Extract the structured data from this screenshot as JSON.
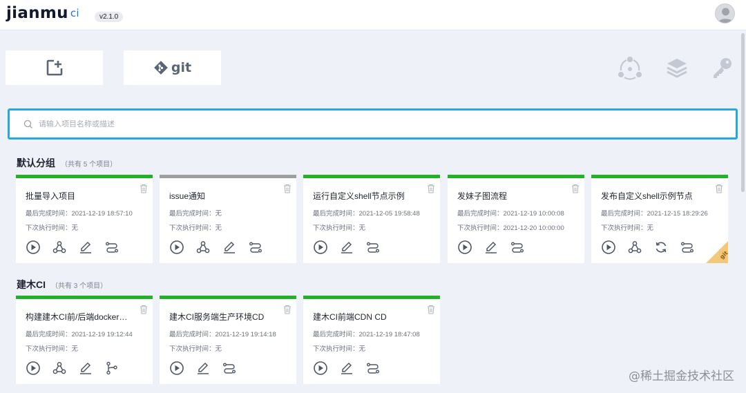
{
  "header": {
    "logo_text": "jianmu",
    "logo_suffix": "ci",
    "version": "v2.1.0"
  },
  "toolbar": {
    "git_label": "git"
  },
  "search": {
    "placeholder": "请输入项目名称或描述"
  },
  "groups": [
    {
      "name": "默认分组",
      "count_text": "（共有 5 个项目）",
      "projects": [
        {
          "name": "批量导入项目",
          "last_label": "最后完成时间：",
          "last_value": "2021-12-19 18:57:10",
          "next_label": "下次执行时间：",
          "next_value": "无",
          "status": "success"
        },
        {
          "name": "issue通知",
          "last_label": "最后完成时间：",
          "last_value": "无",
          "next_label": "下次执行时间：",
          "next_value": "无",
          "status": "never"
        },
        {
          "name": "运行自定义shell节点示例",
          "last_label": "最后完成时间：",
          "last_value": "2021-12-05 19:58:48",
          "next_label": "下次执行时间：",
          "next_value": "无",
          "status": "success"
        },
        {
          "name": "发妹子图流程",
          "last_label": "最后完成时间：",
          "last_value": "2021-12-19 10:00:08",
          "next_label": "下次执行时间：",
          "next_value": "2021-12-20 10:00:00",
          "status": "success"
        },
        {
          "name": "发布自定义shell示例节点",
          "last_label": "最后完成时间：",
          "last_value": "2021-12-15 18:29:26",
          "next_label": "下次执行时间：",
          "next_value": "无",
          "status": "success",
          "corner_badge": "git"
        }
      ]
    },
    {
      "name": "建木CI",
      "count_text": "（共有 3 个项目）",
      "projects": [
        {
          "name": "构建建木CI前/后端docker镜像",
          "last_label": "最后完成时间：",
          "last_value": "2021-12-19 19:12:44",
          "next_label": "下次执行时间：",
          "next_value": "无",
          "status": "success"
        },
        {
          "name": "建木CI服务端生产环境CD",
          "last_label": "最后完成时间：",
          "last_value": "2021-12-19 19:14:18",
          "next_label": "下次执行时间：",
          "next_value": "无",
          "status": "success"
        },
        {
          "name": "建木CI前端CDN CD",
          "last_label": "最后完成时间：",
          "last_value": "2021-12-19 18:47:08",
          "next_label": "下次执行时间：",
          "next_value": "无",
          "status": "success"
        }
      ]
    }
  ],
  "watermark": "@稀土掘金技术社区",
  "icons": {
    "new-project": "plus-square-icon",
    "import-git": "git-icon",
    "graph": "node-graph-icon",
    "layers": "layers-icon",
    "key": "key-icon",
    "trash": "trash-icon",
    "run": "play-icon",
    "dag": "webhook-icon",
    "edit": "pencil-icon",
    "sync": "sync-icon",
    "process": "swap-icon",
    "branch": "branch-icon"
  },
  "colors": {
    "success": "#21b324",
    "never": "#9e9e9e",
    "focus": "#23a8e6",
    "corner_badge": "#f5c77a"
  }
}
